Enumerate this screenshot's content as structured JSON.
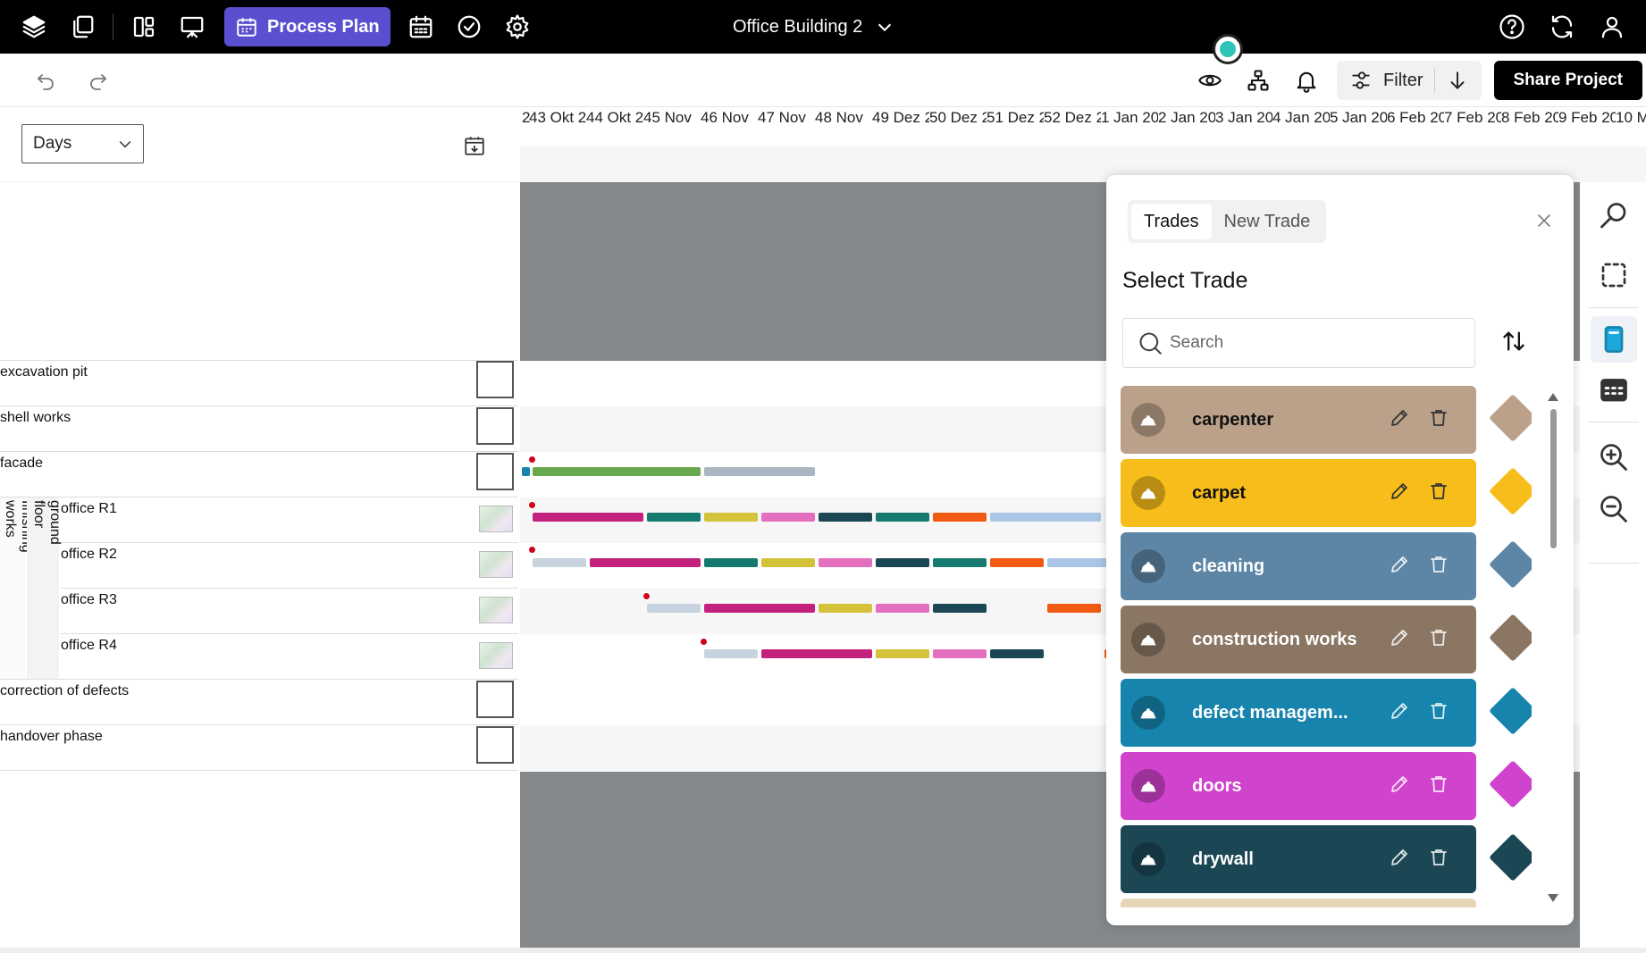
{
  "topbar": {
    "process_plan_label": "Process Plan",
    "project_name": "Office Building 2"
  },
  "toolbar": {
    "filter_label": "Filter",
    "share_label": "Share Project"
  },
  "scale_select": {
    "value": "Days"
  },
  "timeline": {
    "weeks": [
      "2",
      "43 Okt 2",
      "44 Okt 2",
      "45 Nov",
      "46 Nov",
      "47 Nov",
      "48 Nov",
      "49 Dez 2",
      "50 Dez 2",
      "51 Dez 2",
      "52 Dez 2",
      "1 Jan 20",
      "2 Jan 20",
      "3 Jan 20",
      "4 Jan 20",
      "5 Jan 20",
      "6 Feb 20",
      "7 Feb 20",
      "8 Feb 20",
      "9 Feb 20",
      "10 M"
    ]
  },
  "rows": {
    "excavation_pit": "excavation pit",
    "shell_works": "shell works",
    "facade": "facade",
    "finishing_works": "finishing works",
    "ground_floor": "ground floor",
    "office_r1": "office R1",
    "office_r2": "office R2",
    "office_r3": "office R3",
    "office_r4": "office R4",
    "correction_of_defects": "correction of defects",
    "handover_phase": "handover phase"
  },
  "trade_panel": {
    "tabs": [
      "Trades",
      "New Trade"
    ],
    "active_tab": "Trades",
    "title": "Select Trade",
    "search_placeholder": "Search",
    "trades": [
      {
        "name": "carpenter",
        "color": "#bba18a",
        "text_color": "#111111"
      },
      {
        "name": "carpet",
        "color": "#f7bd1b",
        "text_color": "#111111"
      },
      {
        "name": "cleaning",
        "color": "#5d86a6",
        "text_color": "#ffffff"
      },
      {
        "name": "construction works",
        "color": "#8a7663",
        "text_color": "#ffffff"
      },
      {
        "name": "defect managem...",
        "color": "#1684ad",
        "text_color": "#ffffff"
      },
      {
        "name": "doors",
        "color": "#d043cc",
        "text_color": "#ffffff"
      },
      {
        "name": "drywall",
        "color": "#1b4755",
        "text_color": "#ffffff"
      }
    ]
  }
}
